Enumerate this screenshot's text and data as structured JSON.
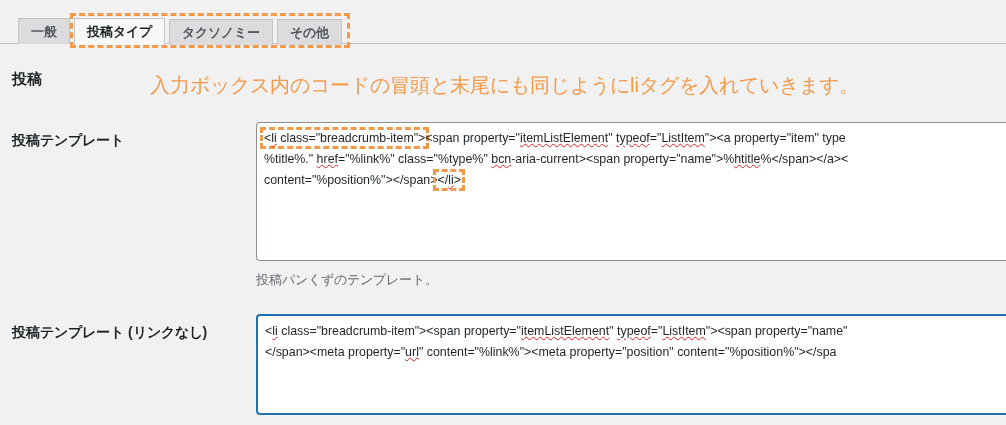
{
  "tabs": [
    {
      "label": "一般",
      "selected": false,
      "outlined": false
    },
    {
      "label": "投稿タイプ",
      "selected": true,
      "outlined": true
    },
    {
      "label": "タクソノミー",
      "selected": false,
      "outlined": true
    },
    {
      "label": "その他",
      "selected": false,
      "outlined": true
    }
  ],
  "section_title": "投稿",
  "annotation": "入力ボックス内のコードの冒頭と末尾にも同じようにliタグを入れていきます。",
  "fields": [
    {
      "label": "投稿テンプレート",
      "focused": false,
      "description": "投稿パンくずのテンプレート。",
      "lines": [
        [
          {
            "highlighted": true,
            "parts": [
              {
                "text": "<",
                "misspelled": false
              },
              {
                "text": "li",
                "misspelled": true
              },
              {
                "text": " class=\"breadcrumb-item\">",
                "misspelled": false
              }
            ]
          },
          {
            "highlighted": false,
            "parts": [
              {
                "text": "<span property=\"",
                "misspelled": false
              },
              {
                "text": "itemListElement",
                "misspelled": true
              },
              {
                "text": "\" ",
                "misspelled": false
              },
              {
                "text": "typeof",
                "misspelled": true
              },
              {
                "text": "=\"",
                "misspelled": false
              },
              {
                "text": "ListItem",
                "misspelled": true
              },
              {
                "text": "\"><a property=\"item\" type",
                "misspelled": false
              }
            ]
          }
        ],
        [
          {
            "highlighted": false,
            "parts": [
              {
                "text": "%title%.\" ",
                "misspelled": false
              },
              {
                "text": "href",
                "misspelled": true
              },
              {
                "text": "=\"%link%\" class=\"%type%\" ",
                "misspelled": false
              },
              {
                "text": "bcn",
                "misspelled": true
              },
              {
                "text": "-aria-current><span property=\"name\">%",
                "misspelled": false
              },
              {
                "text": "htitle",
                "misspelled": true
              },
              {
                "text": "%</span></a><",
                "misspelled": false
              }
            ]
          }
        ],
        [
          {
            "highlighted": false,
            "parts": [
              {
                "text": "content=\"%position%\"></span>",
                "misspelled": false
              }
            ]
          },
          {
            "highlighted": true,
            "parts": [
              {
                "text": "</",
                "misspelled": false
              },
              {
                "text": "li",
                "misspelled": true
              },
              {
                "text": ">",
                "misspelled": false
              }
            ]
          }
        ]
      ]
    },
    {
      "label": "投稿テンプレート (リンクなし)",
      "focused": true,
      "lines": [
        [
          {
            "highlighted": false,
            "parts": [
              {
                "text": "<",
                "misspelled": false
              },
              {
                "text": "li",
                "misspelled": true
              },
              {
                "text": " class=\"breadcrumb-item\"><span property=\"",
                "misspelled": false
              },
              {
                "text": "itemListElement",
                "misspelled": true
              },
              {
                "text": "\" ",
                "misspelled": false
              },
              {
                "text": "typeof",
                "misspelled": true
              },
              {
                "text": "=\"",
                "misspelled": false
              },
              {
                "text": "ListItem",
                "misspelled": true
              },
              {
                "text": "\"><span property=\"name\"",
                "misspelled": false
              }
            ]
          }
        ],
        [
          {
            "highlighted": false,
            "parts": [
              {
                "text": "</span><meta property=\"",
                "misspelled": false
              },
              {
                "text": "url",
                "misspelled": true
              },
              {
                "text": "\" content=\"%link%\"><meta property=\"position\" content=\"%position%\"></spa",
                "misspelled": false
              }
            ]
          }
        ]
      ]
    }
  ]
}
